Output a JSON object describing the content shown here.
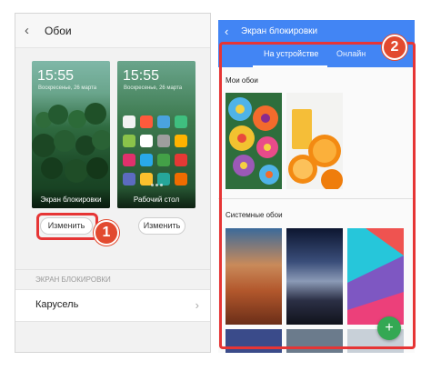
{
  "left_screen": {
    "title": "Обои",
    "lock_preview": {
      "time": "15:55",
      "date": "Воскресенье, 26 марта",
      "caption": "Экран блокировки"
    },
    "home_preview": {
      "time": "15:55",
      "date": "Воскресенье, 26 марта",
      "caption": "Рабочий стол"
    },
    "change_lock_label": "Изменить",
    "change_home_label": "Изменить",
    "section_header": "ЭКРАН БЛОКИРОВКИ",
    "carousel_label": "Карусель"
  },
  "right_screen": {
    "title": "Экран блокировки",
    "tabs": [
      "На устройстве",
      "Онлайн"
    ],
    "my_wallpapers_header": "Мои обои",
    "system_wallpapers_header": "Системные обои",
    "fab_label": "+"
  },
  "callouts": {
    "step1": "1",
    "step2": "2"
  },
  "colors": {
    "accent_blue": "#4285f4",
    "highlight_red": "#e63535",
    "badge_red": "#e24a2f",
    "fab_green": "#34a853"
  }
}
